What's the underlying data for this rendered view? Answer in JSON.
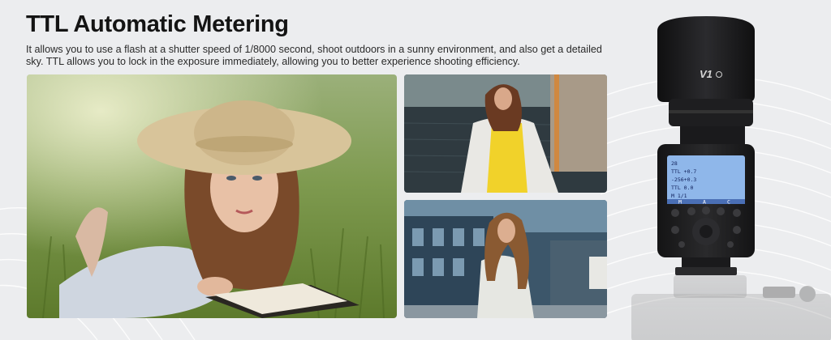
{
  "title": "TTL Automatic Metering",
  "description": "It allows you to use a flash at a shutter speed of 1/8000 second, shoot outdoors in a sunny environment, and also get a detailed sky. TTL allows you to lock in the exposure immediately, allowing you to better experience shooting efficiency.",
  "flash": {
    "model": "V1",
    "lcd": {
      "row1": "28",
      "row2": "TTL +0.7",
      "row3": "-256+0.3",
      "row4": "TTL  0.0",
      "row5": "M   1/1",
      "tabs": [
        "M",
        "A",
        "C"
      ]
    }
  },
  "colors": {
    "background": "#ecedef",
    "flash_body": "#1c1c1e",
    "lcd": "#8fb7ea"
  }
}
